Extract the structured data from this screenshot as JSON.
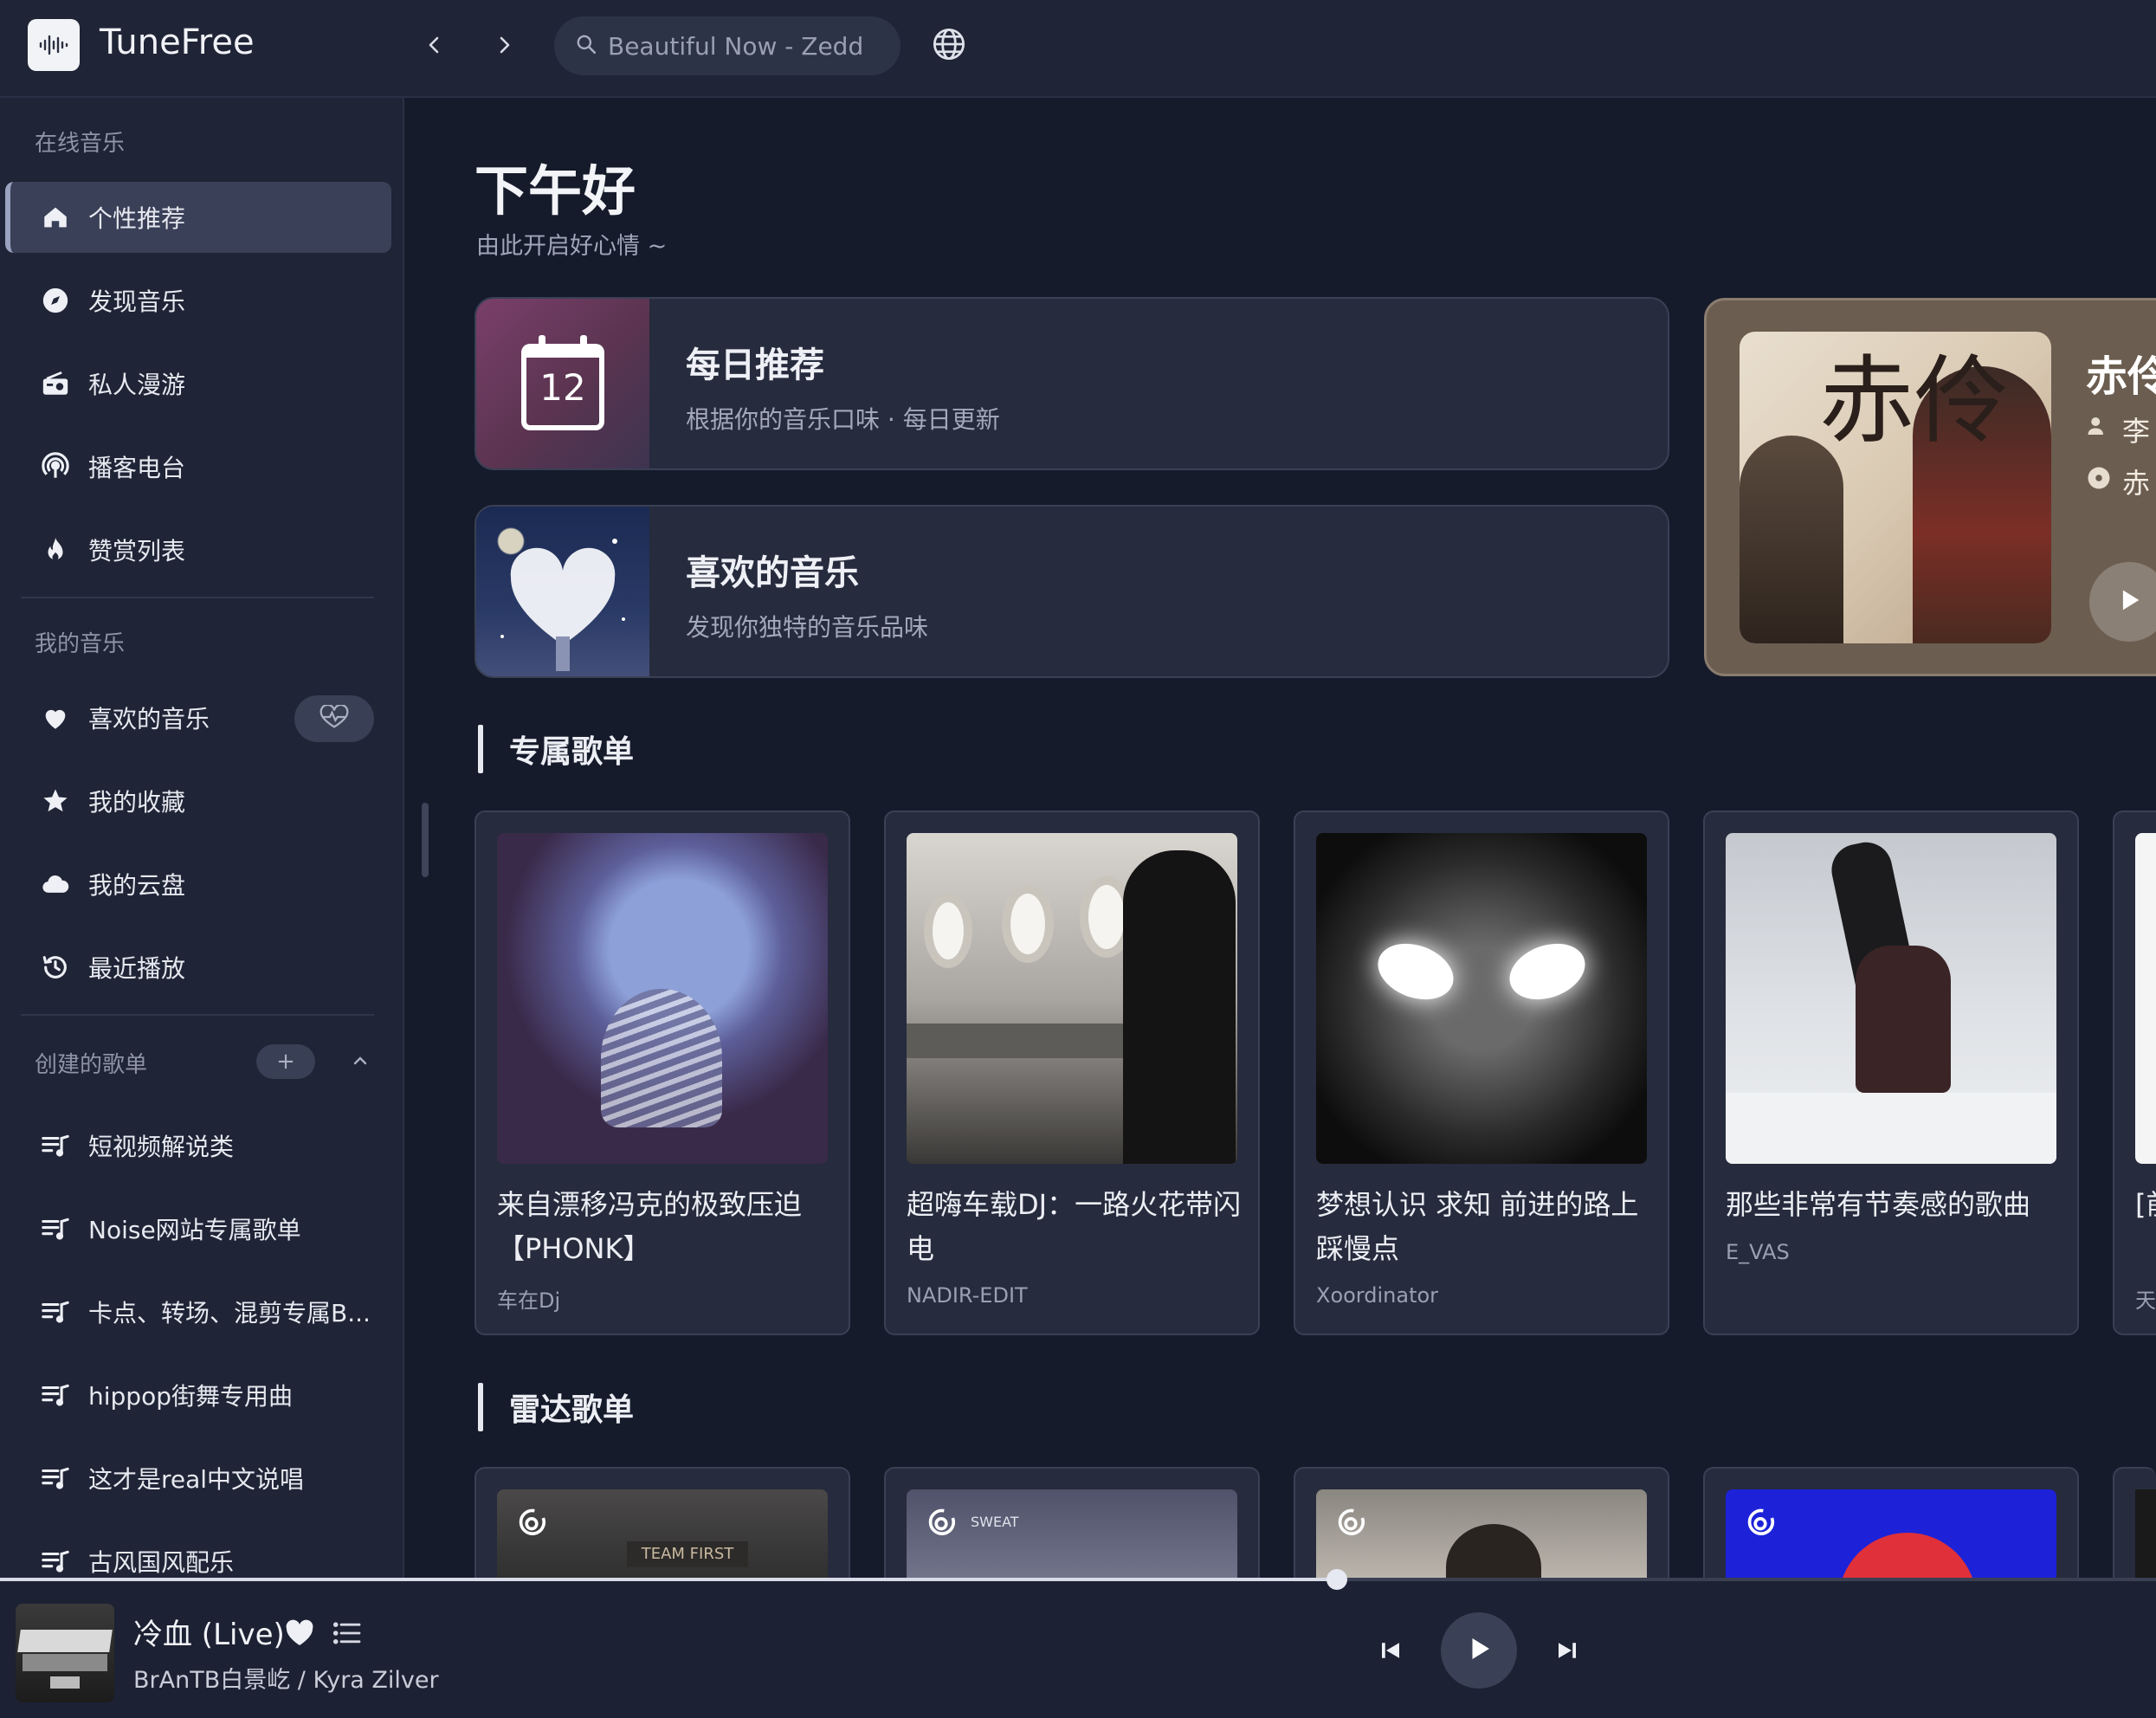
{
  "app": {
    "name": "TuneFree"
  },
  "search": {
    "placeholder": "Beautiful Now - Zedd"
  },
  "sidebar": {
    "online_section": "在线音乐",
    "online_items": [
      {
        "label": "个性推荐",
        "icon": "home-icon",
        "active": true
      },
      {
        "label": "发现音乐",
        "icon": "compass-icon"
      },
      {
        "label": "私人漫游",
        "icon": "radio-icon"
      },
      {
        "label": "播客电台",
        "icon": "podcast-icon"
      },
      {
        "label": "赞赏列表",
        "icon": "fire-icon"
      }
    ],
    "my_section": "我的音乐",
    "my_items": [
      {
        "label": "喜欢的音乐",
        "icon": "heart-icon"
      },
      {
        "label": "我的收藏",
        "icon": "star-icon"
      },
      {
        "label": "我的云盘",
        "icon": "cloud-icon"
      },
      {
        "label": "最近播放",
        "icon": "history-icon"
      }
    ],
    "created_section": "创建的歌单",
    "playlists": [
      {
        "label": "短视频解说类"
      },
      {
        "label": "Noise网站专属歌单"
      },
      {
        "label": "卡点、转场、混剪专属B..."
      },
      {
        "label": "hippop街舞专用曲"
      },
      {
        "label": "这才是real中文说唱"
      },
      {
        "label": "古风国风配乐"
      }
    ]
  },
  "main": {
    "greeting": "下午好",
    "greeting_sub": "由此开启好心情 ~",
    "daily": {
      "title": "每日推荐",
      "subtitle": "根据你的音乐口味 · 每日更新",
      "day": "12"
    },
    "liked": {
      "title": "喜欢的音乐",
      "subtitle": "发现你独特的音乐品味"
    },
    "now_card": {
      "title": "赤伶",
      "artist": "李",
      "album": "赤"
    },
    "exclusive_section": "专属歌单",
    "exclusive": [
      {
        "title": "来自漂移冯克的极致压迫【PHONK】",
        "author": "车在Dj"
      },
      {
        "title": "超嗨车载DJ：一路火花带闪电",
        "author": "NADIR-EDIT"
      },
      {
        "title": "梦想认识 求知 前进的路上踩慢点",
        "author": "Xoordinator"
      },
      {
        "title": "那些非常有节奏感的歌曲",
        "author": "E_VAS"
      },
      {
        "title": "[前战",
        "author": "天"
      }
    ],
    "radar_section": "雷达歌单"
  },
  "player": {
    "title": "冷血 (Live)",
    "artist": "BrAnTB白景屹 / Kyra Zilver",
    "progress": 0.62
  },
  "colors": {
    "background": "#161b2b",
    "panel": "#1f2436",
    "card": "#262b3d",
    "accent": "#9aa2c0"
  }
}
